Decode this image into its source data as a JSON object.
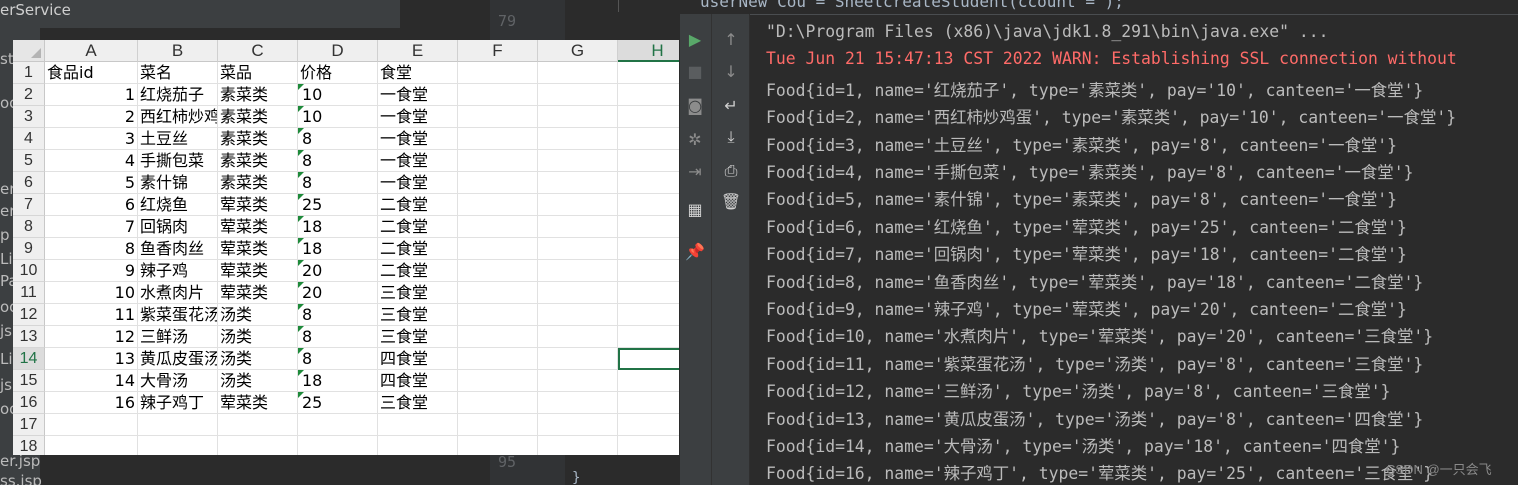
{
  "ide": {
    "tree_top_label": "erService",
    "tree_fragments": [
      "st",
      "",
      "oo",
      "er",
      "er",
      "p",
      "Lis",
      "Pa",
      "oo",
      "js",
      "Li",
      "js",
      "oo"
    ],
    "tree_bottom": [
      "er.jsp",
      "ss.jsp"
    ],
    "gutter_lines": [
      "79",
      "95"
    ],
    "top_code": "userNew Cou = SheetcreateStudent(ccount = );",
    "closing_brace": "}"
  },
  "sheet": {
    "columns": [
      "A",
      "B",
      "C",
      "D",
      "E",
      "F",
      "G",
      "H"
    ],
    "row_numbers": [
      "1",
      "2",
      "3",
      "4",
      "5",
      "6",
      "7",
      "8",
      "9",
      "10",
      "11",
      "12",
      "13",
      "14",
      "15",
      "16",
      "17",
      "18"
    ],
    "active_column": "H",
    "active_row": "14",
    "header_row": [
      "食品id",
      "菜名",
      "菜品",
      "价格",
      "食堂"
    ],
    "rows": [
      [
        "1",
        "红烧茄子",
        "素菜类",
        "10",
        "一食堂"
      ],
      [
        "2",
        "西红柿炒鸡蛋",
        "素菜类",
        "10",
        "一食堂"
      ],
      [
        "3",
        "土豆丝",
        "素菜类",
        "8",
        "一食堂"
      ],
      [
        "4",
        "手撕包菜",
        "素菜类",
        "8",
        "一食堂"
      ],
      [
        "5",
        "素什锦",
        "素菜类",
        "8",
        "一食堂"
      ],
      [
        "6",
        "红烧鱼",
        "荤菜类",
        "25",
        "二食堂"
      ],
      [
        "7",
        "回锅肉",
        "荤菜类",
        "18",
        "二食堂"
      ],
      [
        "8",
        "鱼香肉丝",
        "荤菜类",
        "18",
        "二食堂"
      ],
      [
        "9",
        "辣子鸡",
        "荤菜类",
        "20",
        "二食堂"
      ],
      [
        "10",
        "水煮肉片",
        "荤菜类",
        "20",
        "三食堂"
      ],
      [
        "11",
        "紫菜蛋花汤",
        "汤类",
        "8",
        "三食堂"
      ],
      [
        "12",
        "三鲜汤",
        "汤类",
        "8",
        "三食堂"
      ],
      [
        "13",
        "黄瓜皮蛋汤",
        "汤类",
        "8",
        "四食堂"
      ],
      [
        "14",
        "大骨汤",
        "汤类",
        "18",
        "四食堂"
      ],
      [
        "16",
        "辣子鸡丁",
        "荤菜类",
        "25",
        "三食堂"
      ]
    ]
  },
  "run": {
    "toolbar": [
      "run-icon",
      "stop-icon",
      "camera-icon",
      "settings-debug-icon",
      "exit-icon",
      "layout-icon",
      "pin-icon"
    ],
    "toolbar2": [
      "up-arrow-icon",
      "down-arrow-icon",
      "soft-wrap-icon",
      "scroll-to-end-icon",
      "print-icon",
      "trash-icon"
    ],
    "console_lines": [
      "\"D:\\Program Files (x86)\\java\\jdk1.8_291\\bin\\java.exe\" ...",
      "Tue Jun 21 15:47:13 CST 2022 WARN: Establishing SSL connection without",
      "Food{id=1, name='红烧茄子', type='素菜类', pay='10', canteen='一食堂'}",
      "Food{id=2, name='西红柿炒鸡蛋', type='素菜类', pay='10', canteen='一食堂'}",
      "Food{id=3, name='土豆丝', type='素菜类', pay='8', canteen='一食堂'}",
      "Food{id=4, name='手撕包菜', type='素菜类', pay='8', canteen='一食堂'}",
      "Food{id=5, name='素什锦', type='素菜类', pay='8', canteen='一食堂'}",
      "Food{id=6, name='红烧鱼', type='荤菜类', pay='25', canteen='二食堂'}",
      "Food{id=7, name='回锅肉', type='荤菜类', pay='18', canteen='二食堂'}",
      "Food{id=8, name='鱼香肉丝', type='荤菜类', pay='18', canteen='二食堂'}",
      "Food{id=9, name='辣子鸡', type='荤菜类', pay='20', canteen='二食堂'}",
      "Food{id=10, name='水煮肉片', type='荤菜类', pay='20', canteen='三食堂'}",
      "Food{id=11, name='紫菜蛋花汤', type='汤类', pay='8', canteen='三食堂'}",
      "Food{id=12, name='三鲜汤', type='汤类', pay='8', canteen='三食堂'}",
      "Food{id=13, name='黄瓜皮蛋汤', type='汤类', pay='8', canteen='四食堂'}",
      "Food{id=14, name='大骨汤', type='汤类', pay='18', canteen='四食堂'}",
      "Food{id=16, name='辣子鸡丁', type='荤菜类', pay='25', canteen='三食堂'}"
    ],
    "watermark": "CSDN @一只会飞"
  },
  "colors": {
    "accent": "#217346",
    "error": "#ff6b68",
    "run_green": "#59a869",
    "console_text": "#bbbbbb"
  }
}
